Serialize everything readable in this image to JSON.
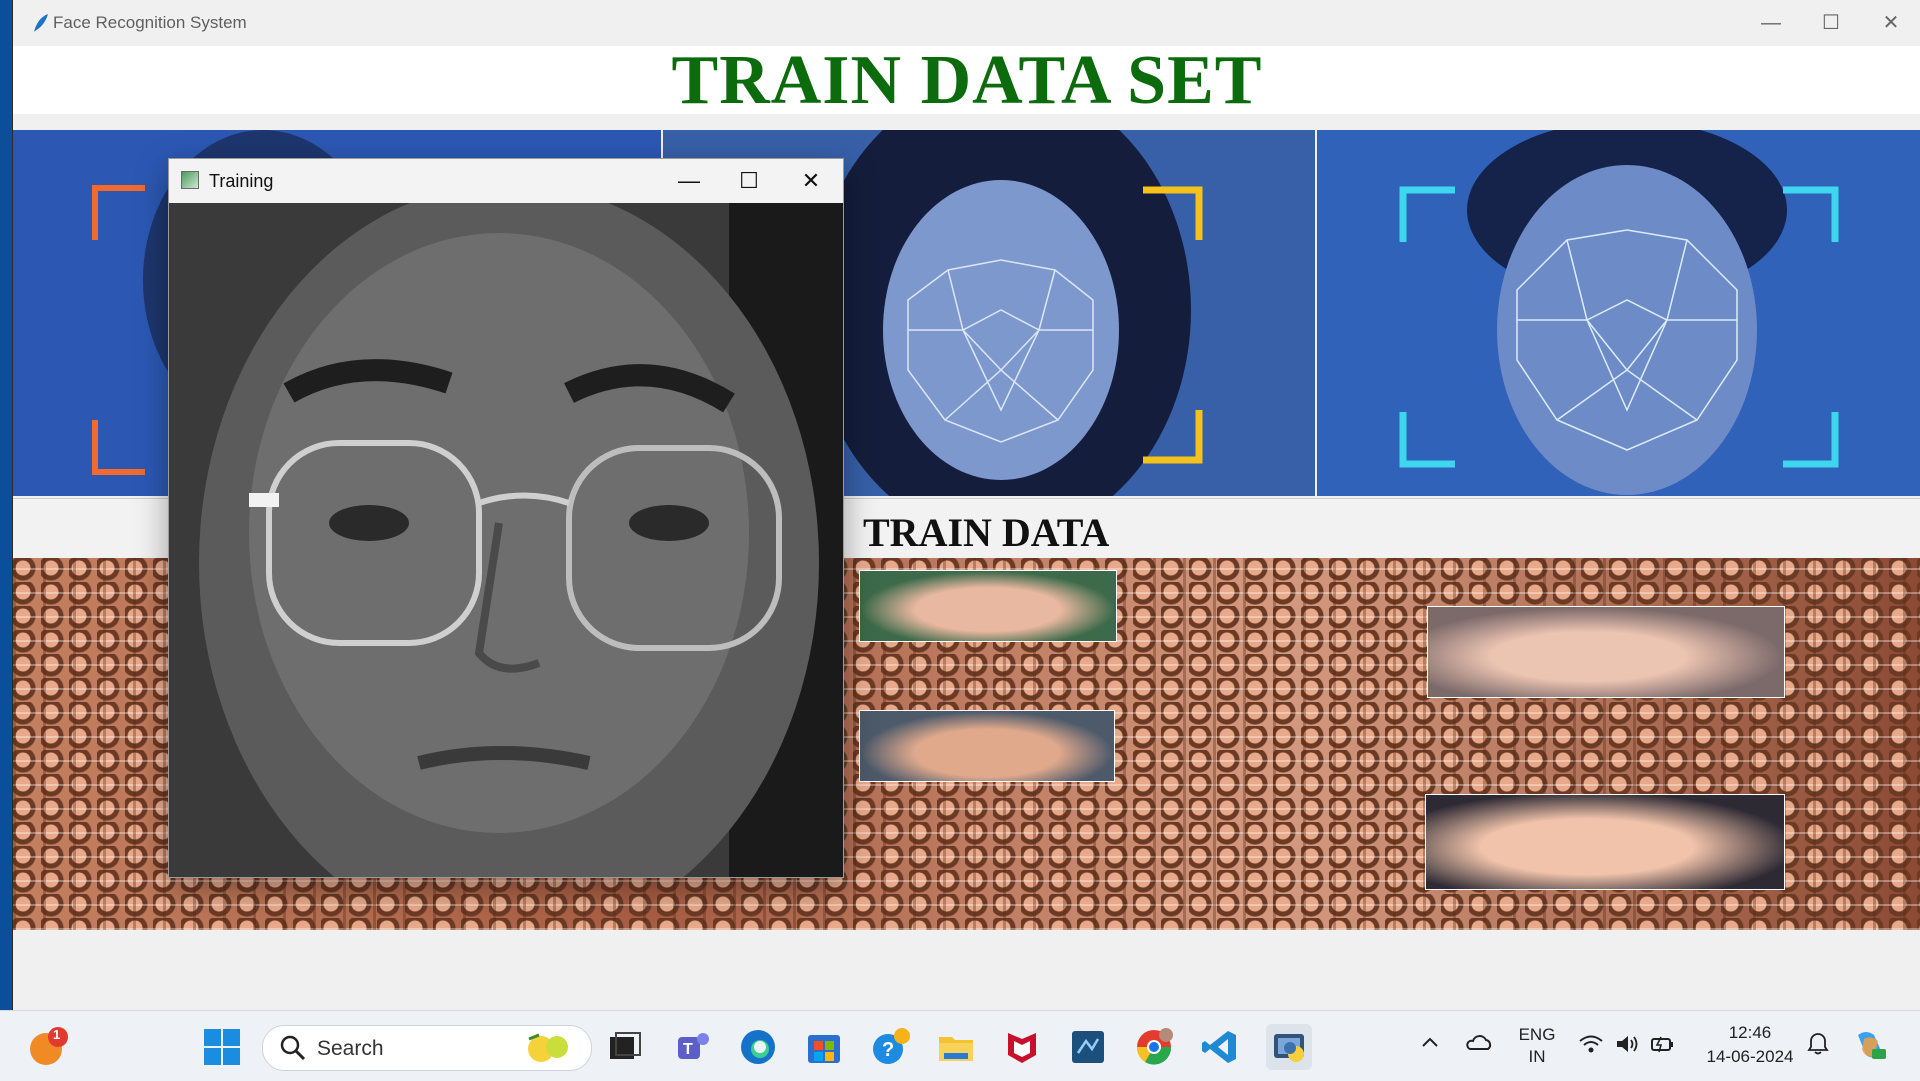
{
  "main_window": {
    "title": "Face Recognition System",
    "controls": {
      "minimize": "—",
      "maximize": "☐",
      "close": "✕"
    }
  },
  "header": {
    "title": "TRAIN DATA SET"
  },
  "section": {
    "label": "TRAIN DATA"
  },
  "training_window": {
    "title": "Training",
    "controls": {
      "minimize": "—",
      "maximize": "☐",
      "close": "✕"
    }
  },
  "taskbar": {
    "notification_badge": "1",
    "search_placeholder": "Search",
    "tray": {
      "language_line1": "ENG",
      "language_line2": "IN",
      "time": "12:46",
      "date": "14-06-2024"
    },
    "apps": [
      "windows-start-icon",
      "task-view-icon",
      "teams-icon",
      "edge-icon",
      "store-icon",
      "help-icon",
      "file-explorer-icon",
      "mcafee-icon",
      "pycharm-icon",
      "chrome-icon",
      "vscode-icon",
      "python-icon"
    ]
  },
  "colors": {
    "header_title": "#0c6b0c",
    "desktop": "#0b4f9a",
    "corner_orange": "#f26a2e",
    "corner_yellow": "#f4c21a",
    "corner_cyan": "#3fd5ee"
  }
}
